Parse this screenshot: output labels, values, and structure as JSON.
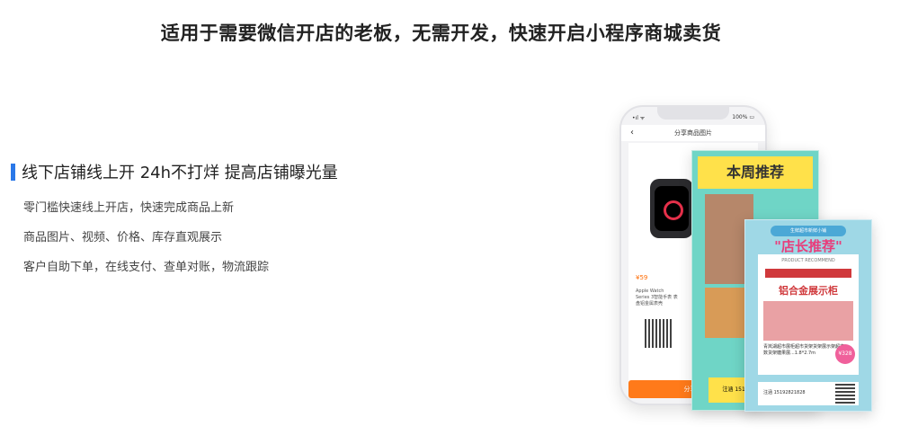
{
  "headline": "适用于需要微信开店的老板，无需开发，快速开启小程序商城卖货",
  "feature": {
    "title": "线下店铺线上开 24h不打烊 提高店铺曝光量",
    "bullets": [
      "零门槛快速线上开店，快速完成商品上新",
      "商品图片、视频、价格、库存直观展示",
      "客户自助下单，在线支付、查单对账，物流跟踪"
    ]
  },
  "phone": {
    "status_signal": "•ıl ᯤ",
    "status_battery": "100% ▭",
    "nav_title": "分享商品图片",
    "back_symbol": "‹",
    "price": "¥59",
    "product_desc": "Apple Watch Series 3智能手表 表盘铝金属表壳",
    "share_button": "分享给"
  },
  "poster_weekly": {
    "banner": "本周推荐",
    "footer": "注涵 1519"
  },
  "poster_manager": {
    "tag": "生鲜超市新鲜小铺",
    "title": "\"店长推荐\"",
    "subtitle": "PRODUCT RECOMMEND",
    "product_name": "铝合金展示柜",
    "desc": "青岚湖超市展柜超市货架货架展示架超市数货架糖果展...1.8*2.7m",
    "badge": "¥328",
    "contact": "注涵 15192821828"
  },
  "colors": {
    "accent": "#2a78e8",
    "orange": "#ff7a1a",
    "pink": "#e83e7b"
  }
}
